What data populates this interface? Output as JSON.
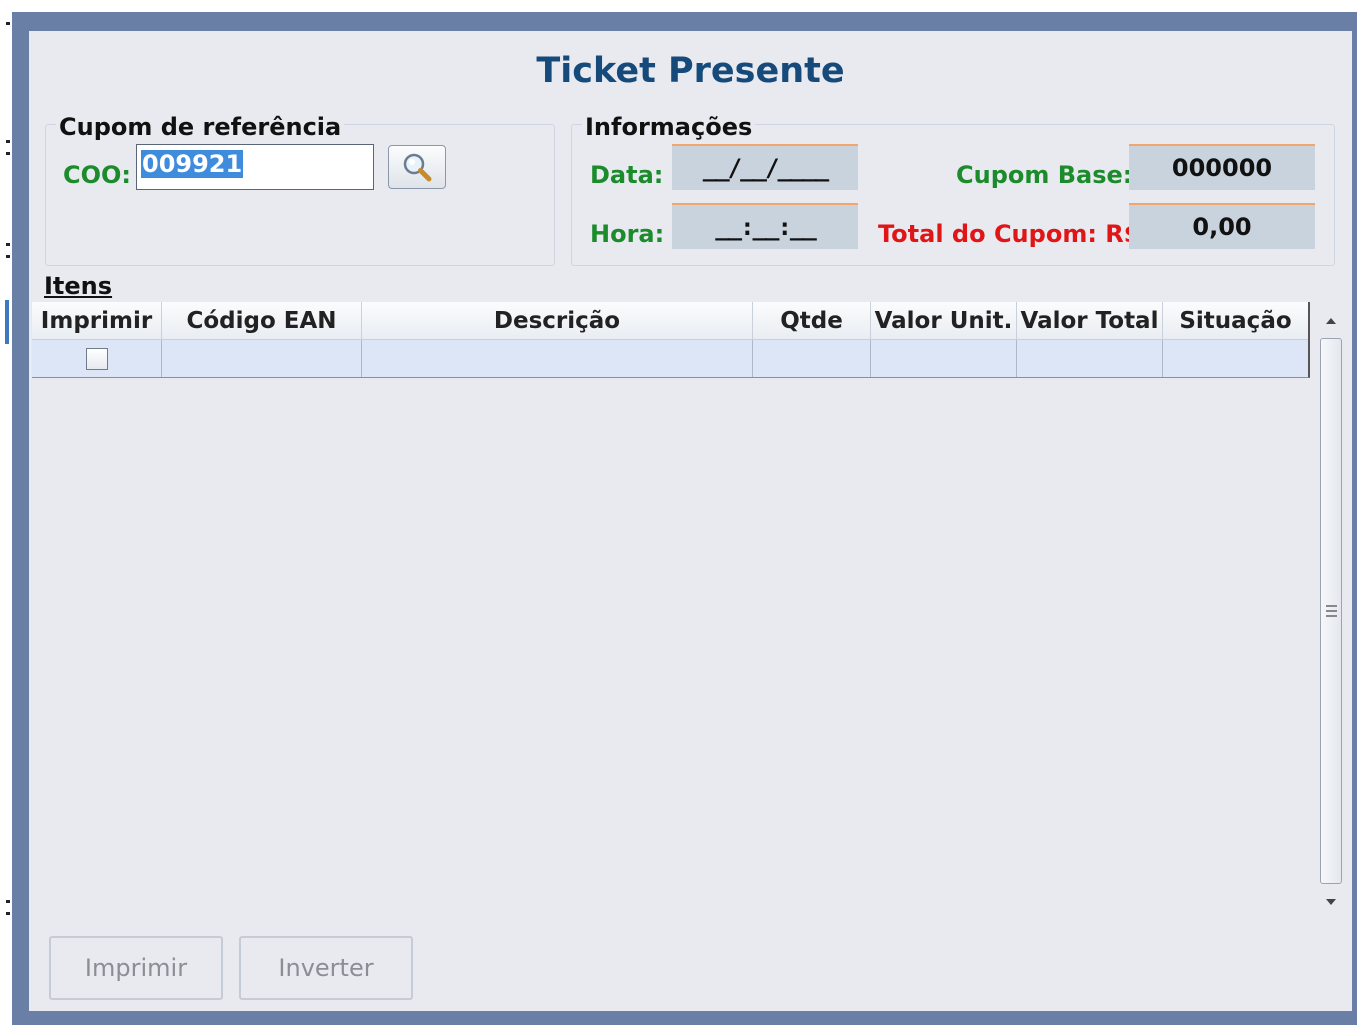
{
  "dialog": {
    "title": "Ticket Presente"
  },
  "cupom_referencia": {
    "group_title": "Cupom de referência",
    "coo_label": "COO:",
    "coo_value": "009921"
  },
  "informacoes": {
    "group_title": "Informações",
    "data_label": "Data:",
    "data_value": "__/__/____",
    "hora_label": "Hora:",
    "hora_value": "__:__:__",
    "cupom_base_label": "Cupom Base:",
    "cupom_base_value": "000000",
    "total_label": "Total do Cupom: R$",
    "total_value": "0,00"
  },
  "itens": {
    "group_title": "Itens",
    "columns": [
      "Imprimir",
      "Código EAN",
      "Descrição",
      "Qtde",
      "Valor Unit.",
      "Valor Total",
      "Situação"
    ],
    "rows": [
      {
        "imprimir": false,
        "codigo_ean": "",
        "descricao": "",
        "qtde": "",
        "valor_unit": "",
        "valor_total": "",
        "situacao": ""
      }
    ]
  },
  "actions": {
    "imprimir_label": "Imprimir",
    "inverter_label": "Inverter"
  },
  "colors": {
    "title": "#164a7a",
    "label_green": "#1c8b2c",
    "label_red": "#e01616",
    "selection": "#3f8cdc"
  },
  "icons": {
    "search": "magnifier-icon"
  }
}
